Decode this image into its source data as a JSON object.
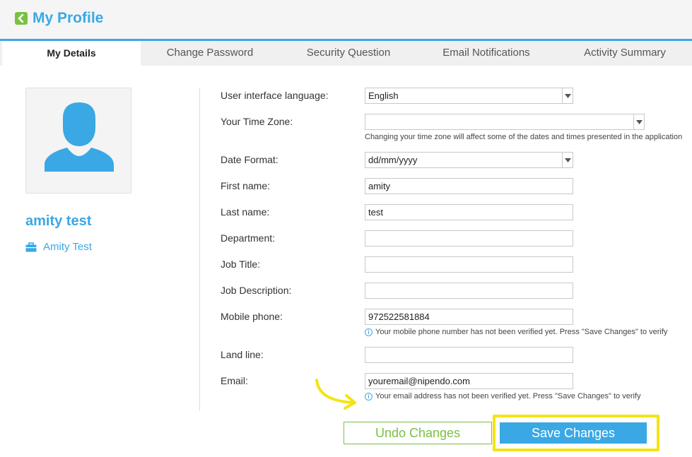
{
  "header": {
    "title": "My Profile"
  },
  "tabs": [
    {
      "label": "My Details",
      "active": true
    },
    {
      "label": "Change Password"
    },
    {
      "label": "Security Question"
    },
    {
      "label": "Email Notifications"
    },
    {
      "label": "Activity Summary"
    }
  ],
  "profile": {
    "name": "amity test",
    "company": "Amity Test"
  },
  "form": {
    "language": {
      "label": "User interface language:",
      "value": "English"
    },
    "timezone": {
      "label": "Your Time Zone:",
      "value": "",
      "hint": "Changing your time zone will affect some of the dates and times presented in the application"
    },
    "date_format": {
      "label": "Date Format:",
      "value": "dd/mm/yyyy"
    },
    "first_name": {
      "label": "First name:",
      "value": "amity"
    },
    "last_name": {
      "label": "Last name:",
      "value": "test"
    },
    "department": {
      "label": "Department:",
      "value": ""
    },
    "job_title": {
      "label": "Job Title:",
      "value": ""
    },
    "job_description": {
      "label": "Job Description:",
      "value": ""
    },
    "mobile": {
      "label": "Mobile phone:",
      "value": "972522581884",
      "hint": "Your mobile phone number has not been verified yet. Press \"Save Changes\" to verify"
    },
    "land_line": {
      "label": "Land line:",
      "value": ""
    },
    "email": {
      "label": "Email:",
      "value": "youremail@nipendo.com",
      "hint": "Your email address has not been verified yet. Press \"Save Changes\" to verify"
    }
  },
  "buttons": {
    "undo": "Undo Changes",
    "save": "Save Changes"
  },
  "colors": {
    "accent": "#3aa8e4",
    "green": "#7ac142",
    "highlight": "#f5e313"
  },
  "icons": {
    "back": "chevron-left-icon",
    "avatar": "user-avatar-icon",
    "company": "briefcase-icon",
    "info": "info-icon",
    "dropdown": "caret-down-icon"
  }
}
